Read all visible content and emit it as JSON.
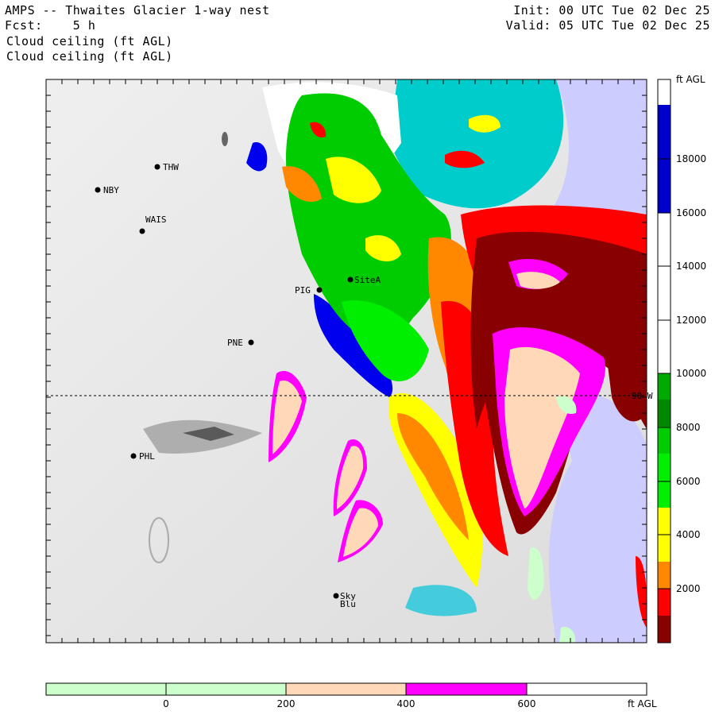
{
  "header": {
    "title": "AMPS -- Thwaites Glacier 1-way nest",
    "forecast": "Fcst:    5 h",
    "init": "Init: 00 UTC Tue 02 Dec 25",
    "valid": "Valid: 05 UTC Tue 02 Dec 25",
    "field_line_1": "Cloud ceiling (ft AGL)",
    "field_line_2": "Cloud ceiling (ft AGL)"
  },
  "map": {
    "latitude_line_label": "90 W",
    "stations": [
      {
        "id": "THW",
        "label": "THW"
      },
      {
        "id": "NBY",
        "label": "NBY"
      },
      {
        "id": "WAIS",
        "label": "WAIS"
      },
      {
        "id": "SiteA",
        "label": "SiteA"
      },
      {
        "id": "PIG",
        "label": "PIG"
      },
      {
        "id": "PNE",
        "label": "PNE"
      },
      {
        "id": "PHL",
        "label": "PHL"
      },
      {
        "id": "Sky",
        "label": "Sky"
      },
      {
        "id": "Blu",
        "label": "Blu"
      }
    ]
  },
  "colorbar_right": {
    "unit": "ft AGL",
    "ticks": [
      "18000",
      "16000",
      "14000",
      "12000",
      "10000",
      "8000",
      "6000",
      "4000",
      "2000"
    ],
    "colors": [
      "#ffffff",
      "#0000cc",
      "#ffffff",
      "#ffffff",
      "#ffffff",
      "#008800",
      "#00cc00",
      "#00ee00",
      "#ffff00",
      "#ffcc00",
      "#ff8800",
      "#ff0000",
      "#880000"
    ]
  },
  "colorbar_bottom": {
    "unit": "ft AGL",
    "ticks": [
      "0",
      "200",
      "400",
      "600"
    ],
    "colors": [
      "#ccffcc",
      "#ccffcc",
      "#ffd8b8",
      "#ff00ff",
      "#ffffff"
    ]
  }
}
